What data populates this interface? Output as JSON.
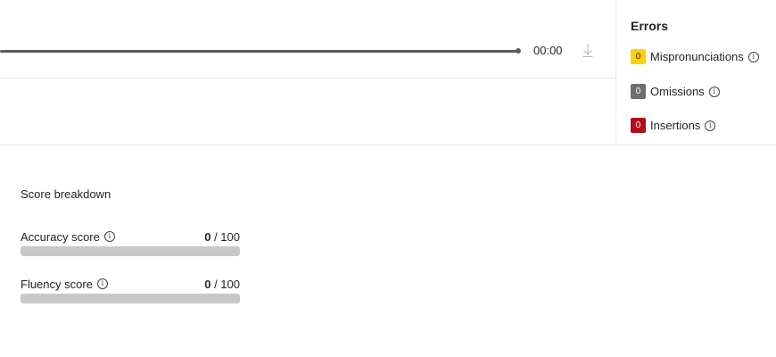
{
  "player": {
    "time": "00:00",
    "download_icon": "download-icon"
  },
  "errors": {
    "title": "Errors",
    "items": [
      {
        "count": "0",
        "label": "Mispronunciations",
        "color": "#fdd000",
        "text_color": "#242424"
      },
      {
        "count": "0",
        "label": "Omissions",
        "color": "#6e6e6e",
        "text_color": "#ffffff"
      },
      {
        "count": "0",
        "label": "Insertions",
        "color": "#b10e1c",
        "text_color": "#ffffff"
      }
    ]
  },
  "scores": {
    "title": "Score breakdown",
    "items": [
      {
        "label": "Accuracy score",
        "value": "0",
        "max": "/ 100",
        "fraction": 0
      },
      {
        "label": "Fluency score",
        "value": "0",
        "max": "/ 100",
        "fraction": 0
      }
    ]
  },
  "edge_text": ")"
}
